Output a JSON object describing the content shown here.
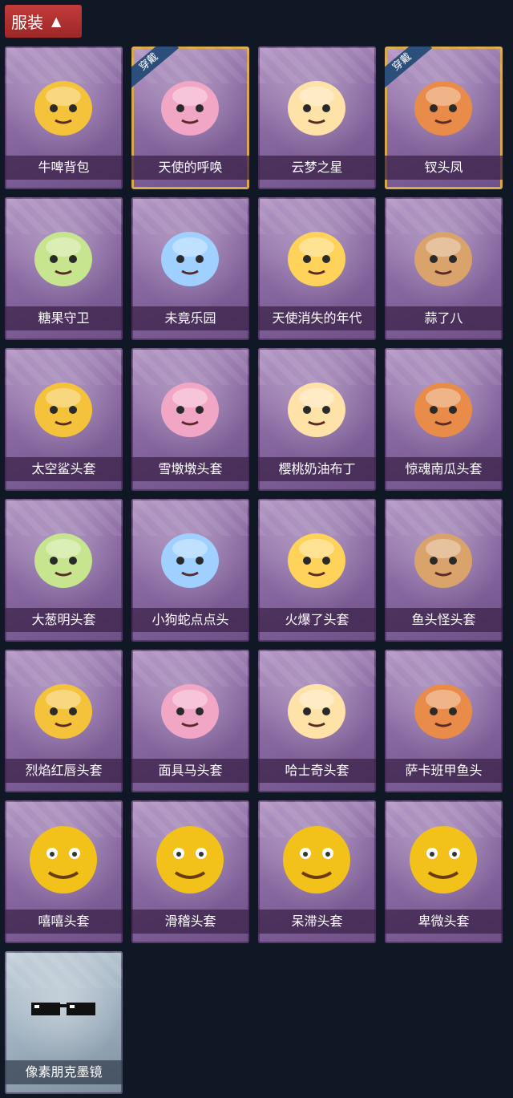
{
  "section": {
    "title": "服装"
  },
  "equipped_badge": "穿戴",
  "items": [
    {
      "name": "牛啤背包",
      "icon": "cow-barrel-backpack-icon",
      "equipped": false
    },
    {
      "name": "天使的呼唤",
      "icon": "angel-girl-icon",
      "equipped": true
    },
    {
      "name": "云梦之星",
      "icon": "unicorn-cloud-icon",
      "equipped": false
    },
    {
      "name": "钗头凤",
      "icon": "phoenix-crown-doll-icon",
      "equipped": true
    },
    {
      "name": "糖果守卫",
      "icon": "pumpkin-scarecrow-icon",
      "equipped": false
    },
    {
      "name": "未竟乐园",
      "icon": "pink-hair-doll-icon",
      "equipped": false
    },
    {
      "name": "天使消失的年代",
      "icon": "angel-doll-icon",
      "equipped": false
    },
    {
      "name": "蒜了八",
      "icon": "garlic-icon",
      "equipped": false
    },
    {
      "name": "太空鲨头套",
      "icon": "shark-head-icon",
      "equipped": false
    },
    {
      "name": "雪墩墩头套",
      "icon": "snowman-head-icon",
      "equipped": false
    },
    {
      "name": "樱桃奶油布丁",
      "icon": "pudding-icon",
      "equipped": false
    },
    {
      "name": "惊魂南瓜头套",
      "icon": "jack-o-lantern-icon",
      "equipped": false
    },
    {
      "name": "大葱明头套",
      "icon": "scallion-head-icon",
      "equipped": false
    },
    {
      "name": "小狗蛇点点头",
      "icon": "dog-snake-head-icon",
      "equipped": false
    },
    {
      "name": "火爆了头套",
      "icon": "fire-head-icon",
      "equipped": false
    },
    {
      "name": "鱼头怪头套",
      "icon": "fish-monster-head-icon",
      "equipped": false
    },
    {
      "name": "烈焰红唇头套",
      "icon": "pikachu-lips-head-icon",
      "equipped": false
    },
    {
      "name": "面具马头套",
      "icon": "horse-mask-icon",
      "equipped": false
    },
    {
      "name": "哈士奇头套",
      "icon": "husky-head-icon",
      "equipped": false
    },
    {
      "name": "萨卡班甲鱼头",
      "icon": "sacabambaspis-head-icon",
      "equipped": false
    },
    {
      "name": "嘻嘻头套",
      "icon": "grin-emoji-head-icon",
      "equipped": false
    },
    {
      "name": "滑稽头套",
      "icon": "funny-emoji-head-icon",
      "equipped": false
    },
    {
      "name": "呆滞头套",
      "icon": "dazed-emoji-head-icon",
      "equipped": false
    },
    {
      "name": "卑微头套",
      "icon": "humble-emoji-head-icon",
      "equipped": false
    },
    {
      "name": "像素朋克墨镜",
      "icon": "pixel-sunglasses-icon",
      "equipped": false
    }
  ],
  "colors": {
    "background": "#101826",
    "header_red": "#c43b3b",
    "card_purple": "#8b6aa3",
    "equipped_gold": "#d8a94a",
    "badge_blue": "#2c4e7a"
  }
}
